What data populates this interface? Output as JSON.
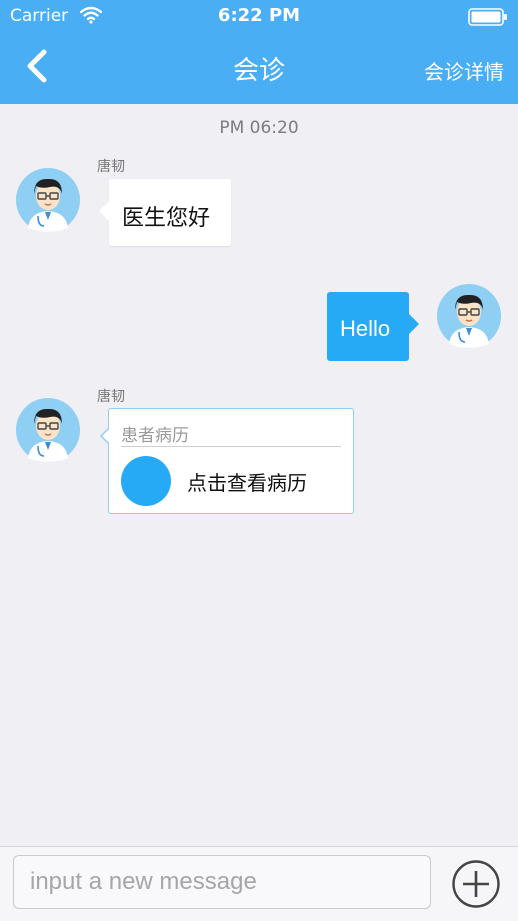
{
  "status": {
    "carrier": "Carrier",
    "time": "6:22 PM"
  },
  "nav": {
    "title": "会诊",
    "right_label": "会诊详情"
  },
  "chat": {
    "timestamp": "PM 06:20",
    "messages": [
      {
        "sender": "唐韧",
        "text": "医生您好"
      },
      {
        "text": "Hello"
      },
      {
        "sender": "唐韧",
        "card_title": "患者病历",
        "card_action": "点击查看病历"
      }
    ]
  },
  "input": {
    "placeholder": "input a new message"
  },
  "colors": {
    "accent": "#4aaef5",
    "bubble_out": "#27aaf6",
    "background": "#efeff4"
  },
  "icons": [
    "wifi-icon",
    "battery-icon",
    "back-chevron-icon",
    "doctor-avatar-icon",
    "plus-circle-icon"
  ]
}
